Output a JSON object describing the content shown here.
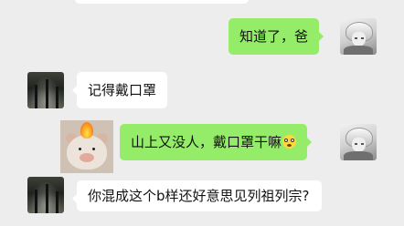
{
  "messages": [
    {
      "side": "out",
      "text": "知道了，爸"
    },
    {
      "side": "in",
      "text": "记得戴口罩"
    },
    {
      "side": "out",
      "text": "山上又没人，戴口罩干嘛",
      "emoji": "flushed-face-emoji"
    },
    {
      "side": "in",
      "text": "你混成这个b样还好意思见列祖列宗?"
    }
  ],
  "colors": {
    "background": "#ededed",
    "incoming_bubble": "#ffffff",
    "outgoing_bubble": "#95ec69"
  }
}
